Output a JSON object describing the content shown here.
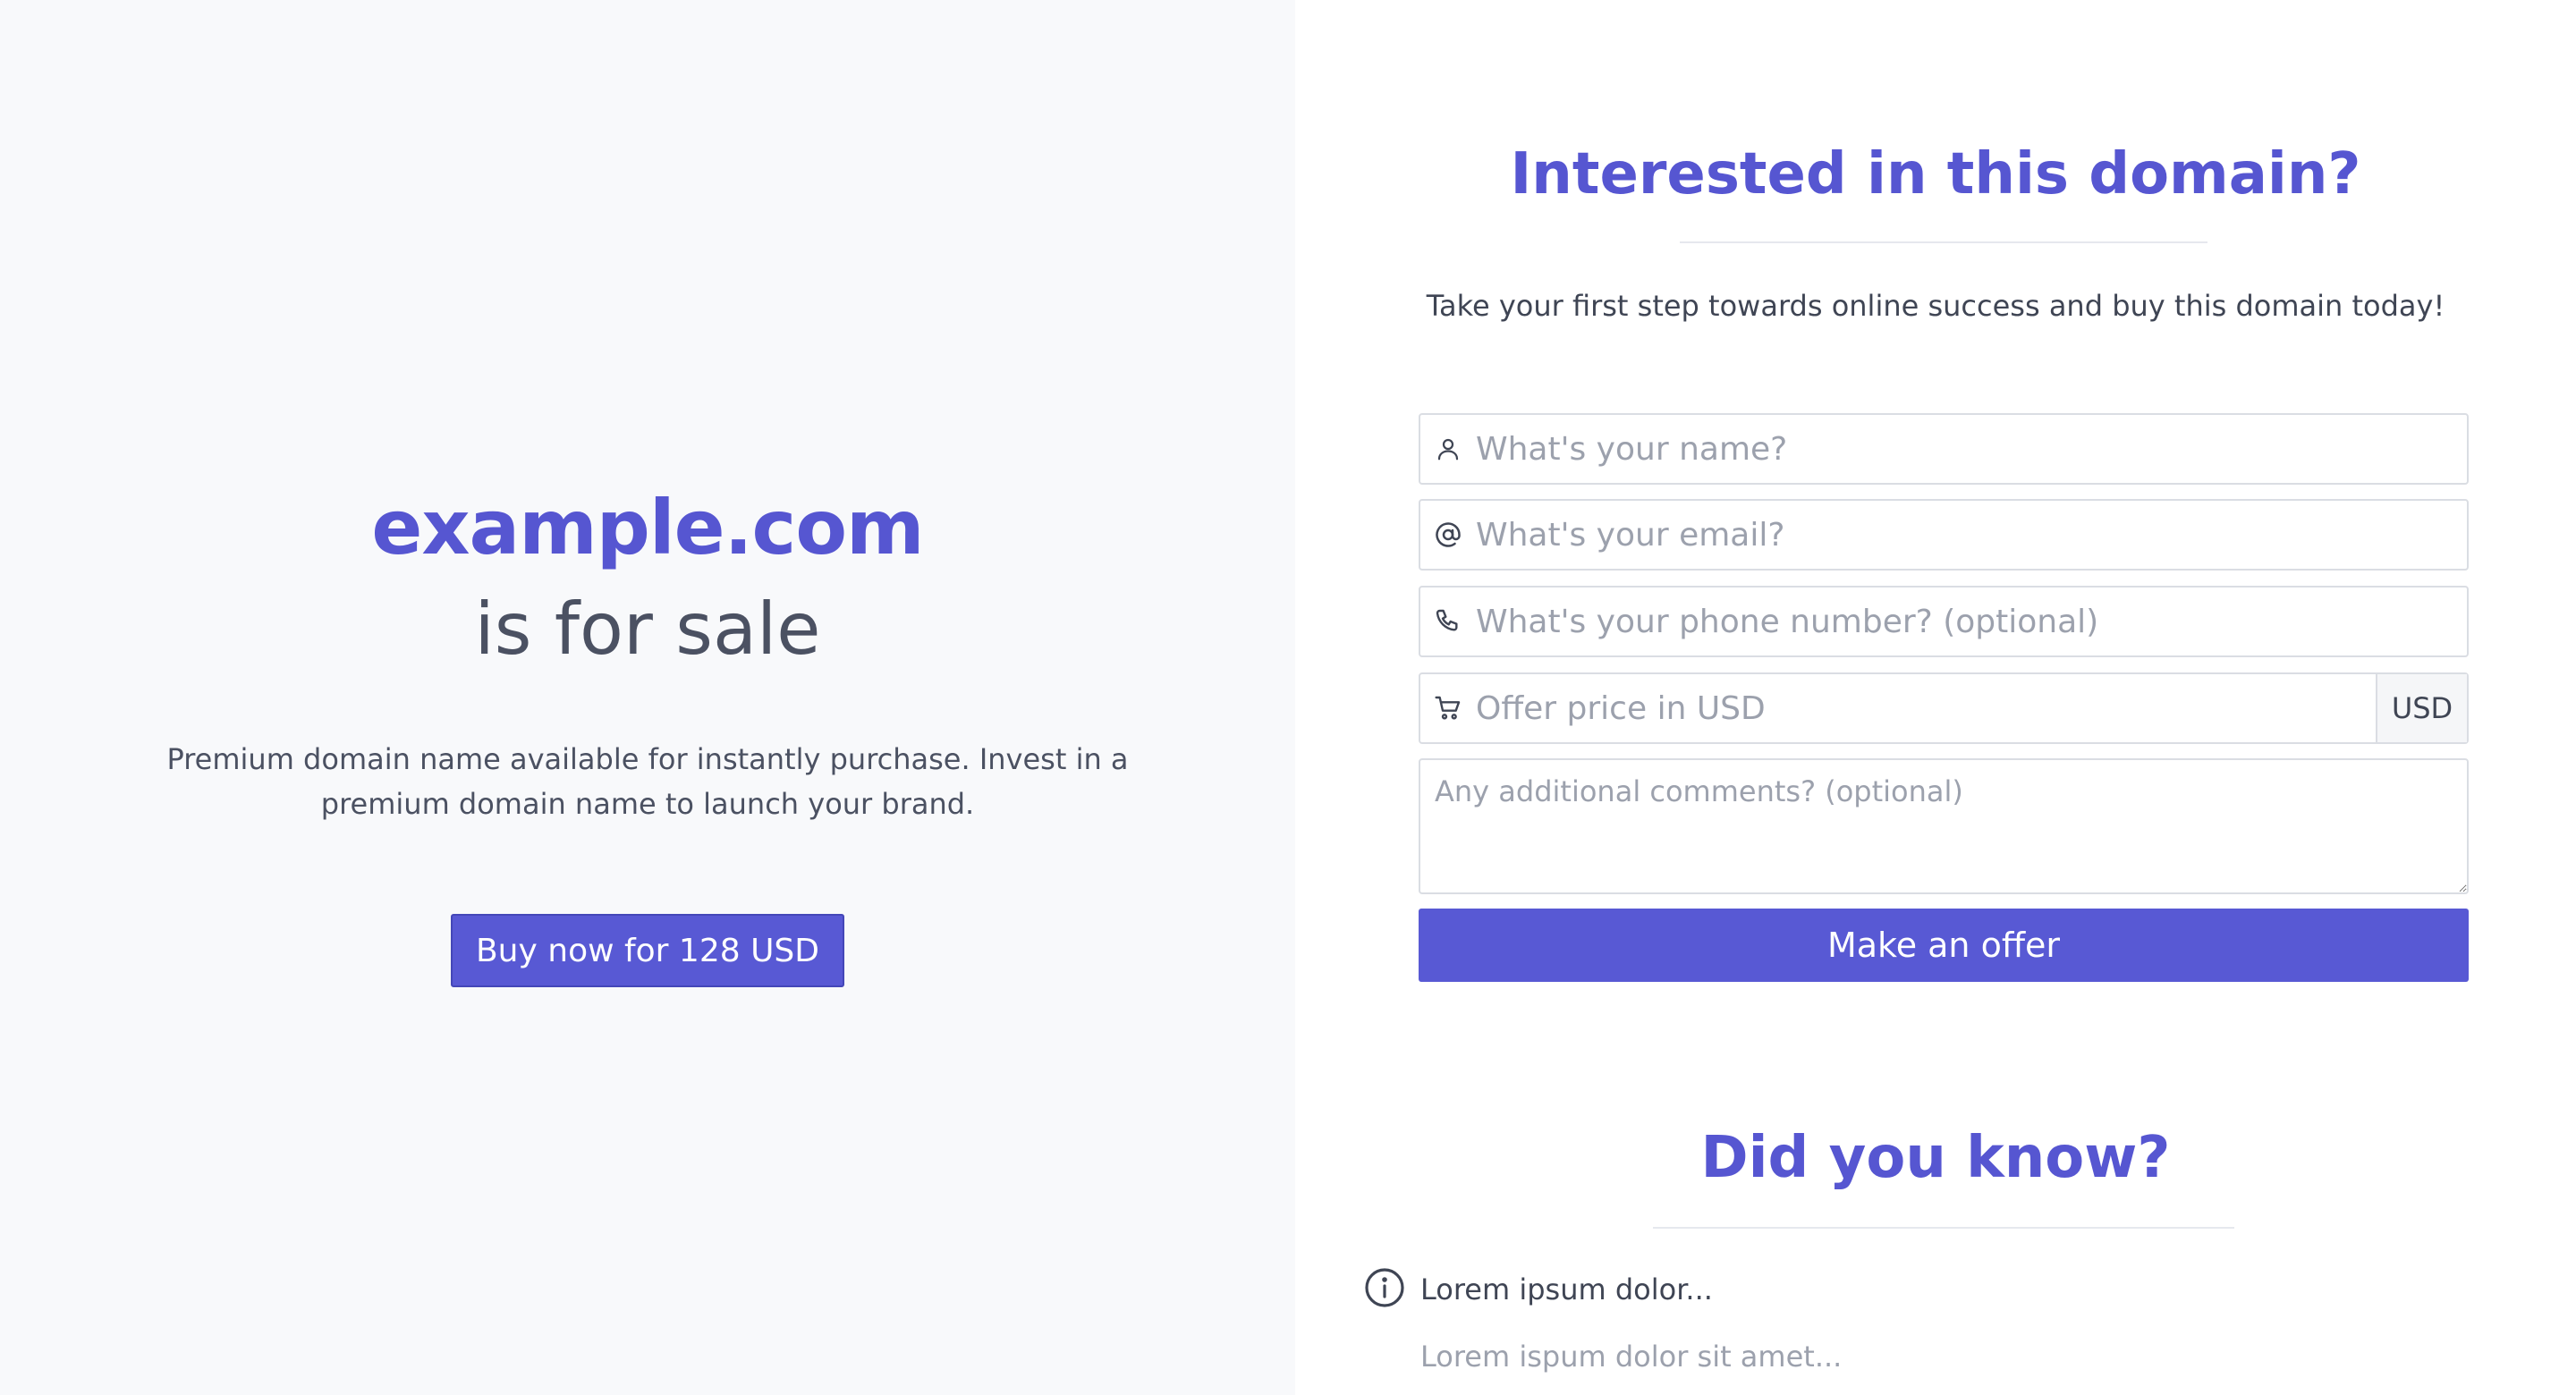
{
  "hero": {
    "domain": "example.com",
    "status": "is for sale",
    "description": "Premium domain name available for instantly purchase. Invest in a premium domain name to launch your brand.",
    "buy_label": "Buy now for 128 USD"
  },
  "form": {
    "title": "Interested in this domain?",
    "subtitle": "Take your first step towards online success and buy this domain today!",
    "name_placeholder": "What's your name?",
    "email_placeholder": "What's your email?",
    "phone_placeholder": "What's your phone number? (optional)",
    "offer_placeholder": "Offer price in USD",
    "currency": "USD",
    "comments_placeholder": "Any additional comments? (optional)",
    "submit_label": "Make an offer"
  },
  "facts": {
    "title": "Did you know?",
    "item_title": "Lorem ipsum dolor...",
    "item_text": "Lorem ispum dolor sit amet..."
  },
  "icons": {
    "name": "user-icon",
    "email": "at-icon",
    "phone": "phone-icon",
    "offer": "cart-icon",
    "fact": "info-icon"
  },
  "colors": {
    "accent": "#5656d1",
    "button": "#5859d4",
    "left_background": "#f8f9fb",
    "text": "#4b5162",
    "placeholder": "#9ca1ad"
  }
}
